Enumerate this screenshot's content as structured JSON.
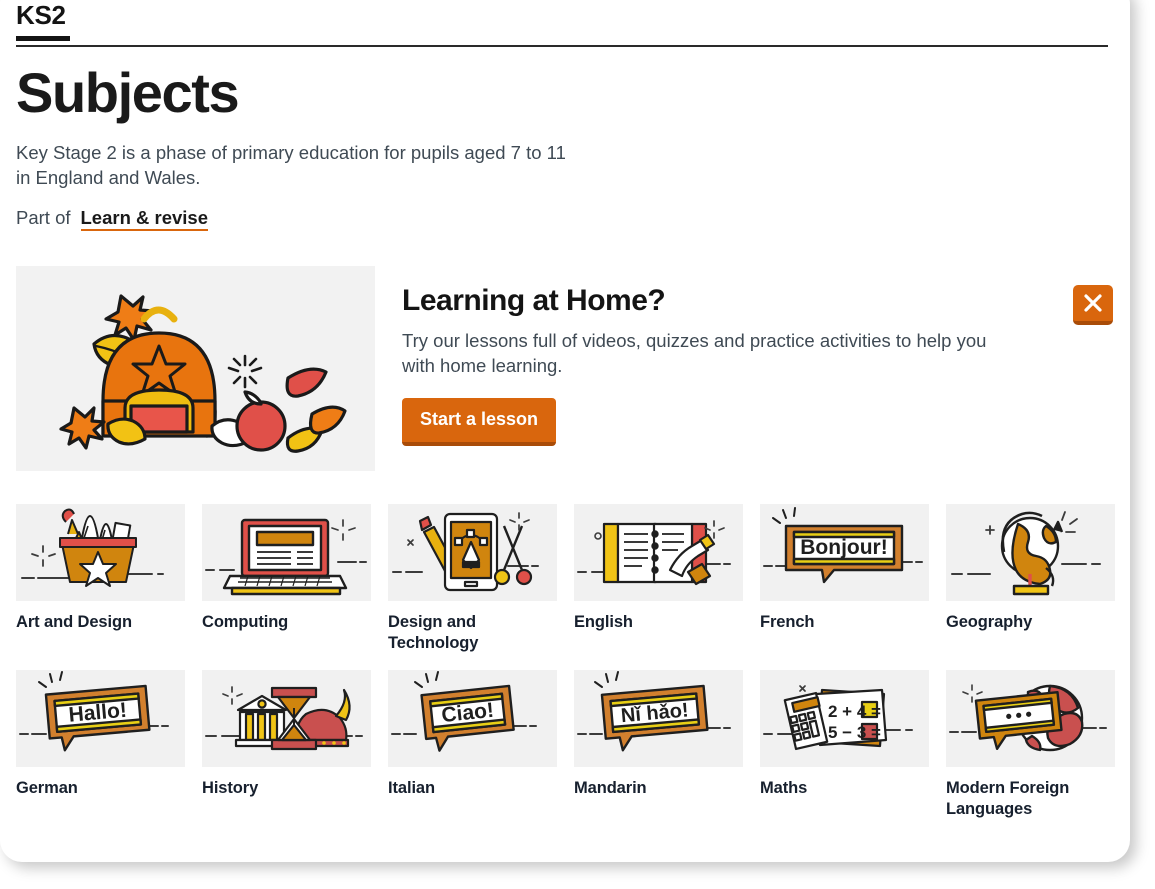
{
  "breadcrumb": {
    "label": "KS2"
  },
  "header": {
    "title": "Subjects",
    "intro": "Key Stage 2 is a phase of primary education for pupils aged 7 to 11 in England and Wales.",
    "part_of_prefix": "Part of",
    "part_of_link": "Learn & revise"
  },
  "promo": {
    "title": "Learning at Home?",
    "text": "Try our lessons full of videos, quizzes and practice activities to help you with home learning.",
    "cta_label": "Start a lesson",
    "close_label": "Close",
    "image_alt": "backpack-with-autumn-leaves-illustration"
  },
  "colors": {
    "accent_orange": "#d9660d",
    "accent_orange_dark": "#a94c08",
    "tile_bg": "#f1f1f1",
    "label_navy": "#17202e",
    "body_text": "#3f4a54"
  },
  "subjects": [
    {
      "label": "Art and Design",
      "icon": "pencil-pot-icon"
    },
    {
      "label": "Computing",
      "icon": "laptop-icon"
    },
    {
      "label": "Design and Technology",
      "icon": "tablet-pen-scissors-icon"
    },
    {
      "label": "English",
      "icon": "notebook-writing-hand-icon"
    },
    {
      "label": "French",
      "icon": "speech-bubble-bonjour-icon",
      "bubble_text": "Bonjour!"
    },
    {
      "label": "Geography",
      "icon": "globe-stand-icon"
    },
    {
      "label": "German",
      "icon": "speech-bubble-hallo-icon",
      "bubble_text": "Hallo!"
    },
    {
      "label": "History",
      "icon": "hourglass-temple-helmet-icon"
    },
    {
      "label": "Italian",
      "icon": "speech-bubble-ciao-icon",
      "bubble_text": "Ciao!"
    },
    {
      "label": "Mandarin",
      "icon": "speech-bubble-nihao-icon",
      "bubble_text": "Nǐ hǎo!"
    },
    {
      "label": "Maths",
      "icon": "calculator-sums-icon",
      "sum_1": "2 + 4 =",
      "sum_2": "5 − 3 ="
    },
    {
      "label": "Modern Foreign Languages",
      "icon": "speech-bubble-globe-icon",
      "bubble_text": "•••"
    }
  ]
}
